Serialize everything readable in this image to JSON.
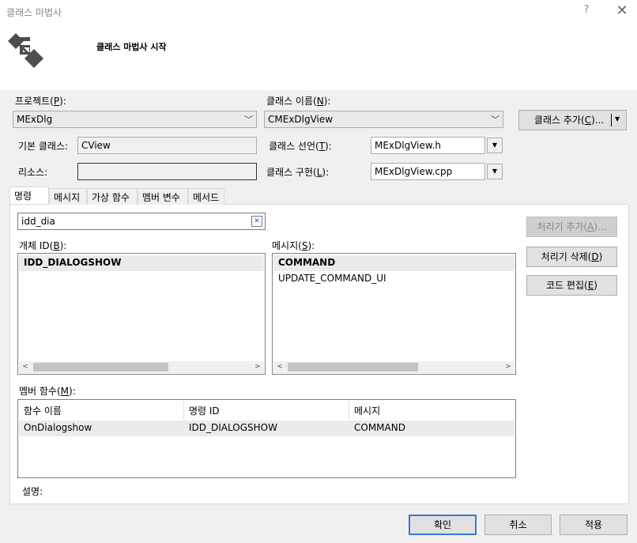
{
  "window": {
    "title": "클래스 마법사",
    "help": "?",
    "close": "✕"
  },
  "header": {
    "title": "클래스 마법사 시작"
  },
  "project": {
    "label_pre": "프로젝트(",
    "label_key": "P",
    "label_post": "):",
    "value": "MExDlg"
  },
  "class_name": {
    "label_pre": "클래스 이름(",
    "label_key": "N",
    "label_post": "):",
    "value": "CMExDlgView"
  },
  "add_class_button": {
    "label_pre": "클래스 추가(",
    "label_key": "C",
    "label_post": ")..."
  },
  "base_class": {
    "label": "기본 클래스:",
    "value": "CView"
  },
  "class_decl": {
    "label_pre": "클래스 선언(",
    "label_key": "T",
    "label_post": "):",
    "value": "MExDlgView.h"
  },
  "resource": {
    "label": "리소스:",
    "value": ""
  },
  "class_impl": {
    "label_pre": "클래스 구현(",
    "label_key": "L",
    "label_post": "):",
    "value": "MExDlgView.cpp"
  },
  "tabs": [
    "명령",
    "메시지",
    "가상 함수",
    "멤버 변수",
    "메서드"
  ],
  "search": {
    "value": "idd_dia",
    "clear": "✕"
  },
  "object_ids": {
    "label_pre": "개체 ID(",
    "label_key": "B",
    "label_post": "):",
    "items": [
      "IDD_DIALOGSHOW"
    ]
  },
  "messages": {
    "label_pre": "메시지(",
    "label_key": "S",
    "label_post": "):",
    "items": [
      "COMMAND",
      "UPDATE_COMMAND_UI"
    ]
  },
  "buttons": {
    "add_handler": {
      "pre": "처리기 추가(",
      "key": "A",
      "post": ")..."
    },
    "delete_handler": {
      "pre": "처리기 삭제(",
      "key": "D",
      "post": ")"
    },
    "edit_code": {
      "pre": "코드 편집(",
      "key": "E",
      "post": ")"
    }
  },
  "member_functions": {
    "label_pre": "멤버 함수(",
    "label_key": "M",
    "label_post": "):",
    "columns": [
      "함수 이름",
      "명령 ID",
      "메시지"
    ],
    "rows": [
      [
        "OnDialogshow",
        "IDD_DIALOGSHOW",
        "COMMAND"
      ]
    ]
  },
  "description": {
    "label": "설명:"
  },
  "footer": {
    "ok": "확인",
    "cancel": "취소",
    "apply": "적용"
  }
}
